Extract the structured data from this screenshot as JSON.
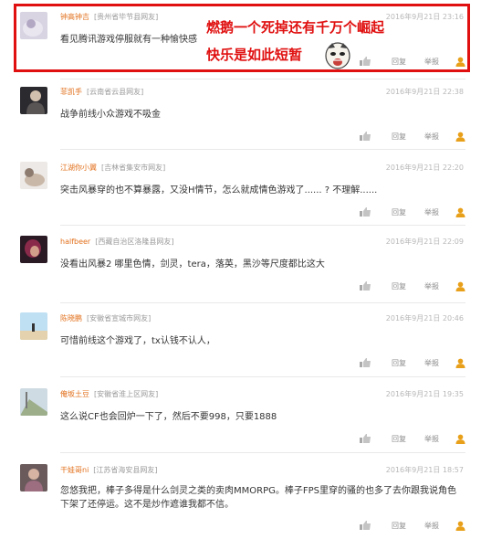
{
  "comments": [
    {
      "username": "钟高钟吉",
      "location": "[贵州省毕节县网友]",
      "time": "2016年9月21日 23:16",
      "text": "看见腾讯游戏停服就有一种愉快感"
    },
    {
      "username": "菲凯手",
      "location": "[云南省云县网友]",
      "time": "2016年9月21日 22:38",
      "text": "战争前线小众游戏不吸金"
    },
    {
      "username": "江湖你小翼",
      "location": "[吉林省集安市网友]",
      "time": "2016年9月21日 22:20",
      "text": "突击风暴穿的也不算暴露，又没H情节，怎么就成情色游戏了...... ? 不理解......"
    },
    {
      "username": "halfbeer",
      "location": "[西藏自治区洛隆县网友]",
      "time": "2016年9月21日 22:09",
      "text": "没看出风暴2 哪里色情，剑灵，tera，落英，黑沙等尺度都比这大"
    },
    {
      "username": "陈晓鹏",
      "location": "[安徽省宣城市网友]",
      "time": "2016年9月21日 20:46",
      "text": "可惜前线这个游戏了，tx认钱不认人，"
    },
    {
      "username": "俺坂土豆",
      "location": "[安徽省淮上区网友]",
      "time": "2016年9月21日 19:35",
      "text": "这么说CF也会回炉一下了，然后不要998，只要1888"
    },
    {
      "username": "干娃哥ni",
      "location": "[江苏省海安县网友]",
      "time": "2016年9月21日 18:57",
      "text": "忽悠我把，棒子多得是什么剑灵之类的卖肉MMORPG。棒子FPS里穿的骚的也多了去你跟我说角色下架了还停运。这不是炒作遮谁我都不信。"
    }
  ],
  "actions": {
    "reply": "回复",
    "report": "举报"
  },
  "overlay": {
    "line1": "燃鹅一个死掉还有千万个崛起",
    "line2": "快乐是如此短暂"
  },
  "colors": {
    "highlight": "#e01010",
    "username": "#e2701c"
  },
  "icons": {
    "like": "thumbs-up-icon",
    "user": "user-icon"
  }
}
